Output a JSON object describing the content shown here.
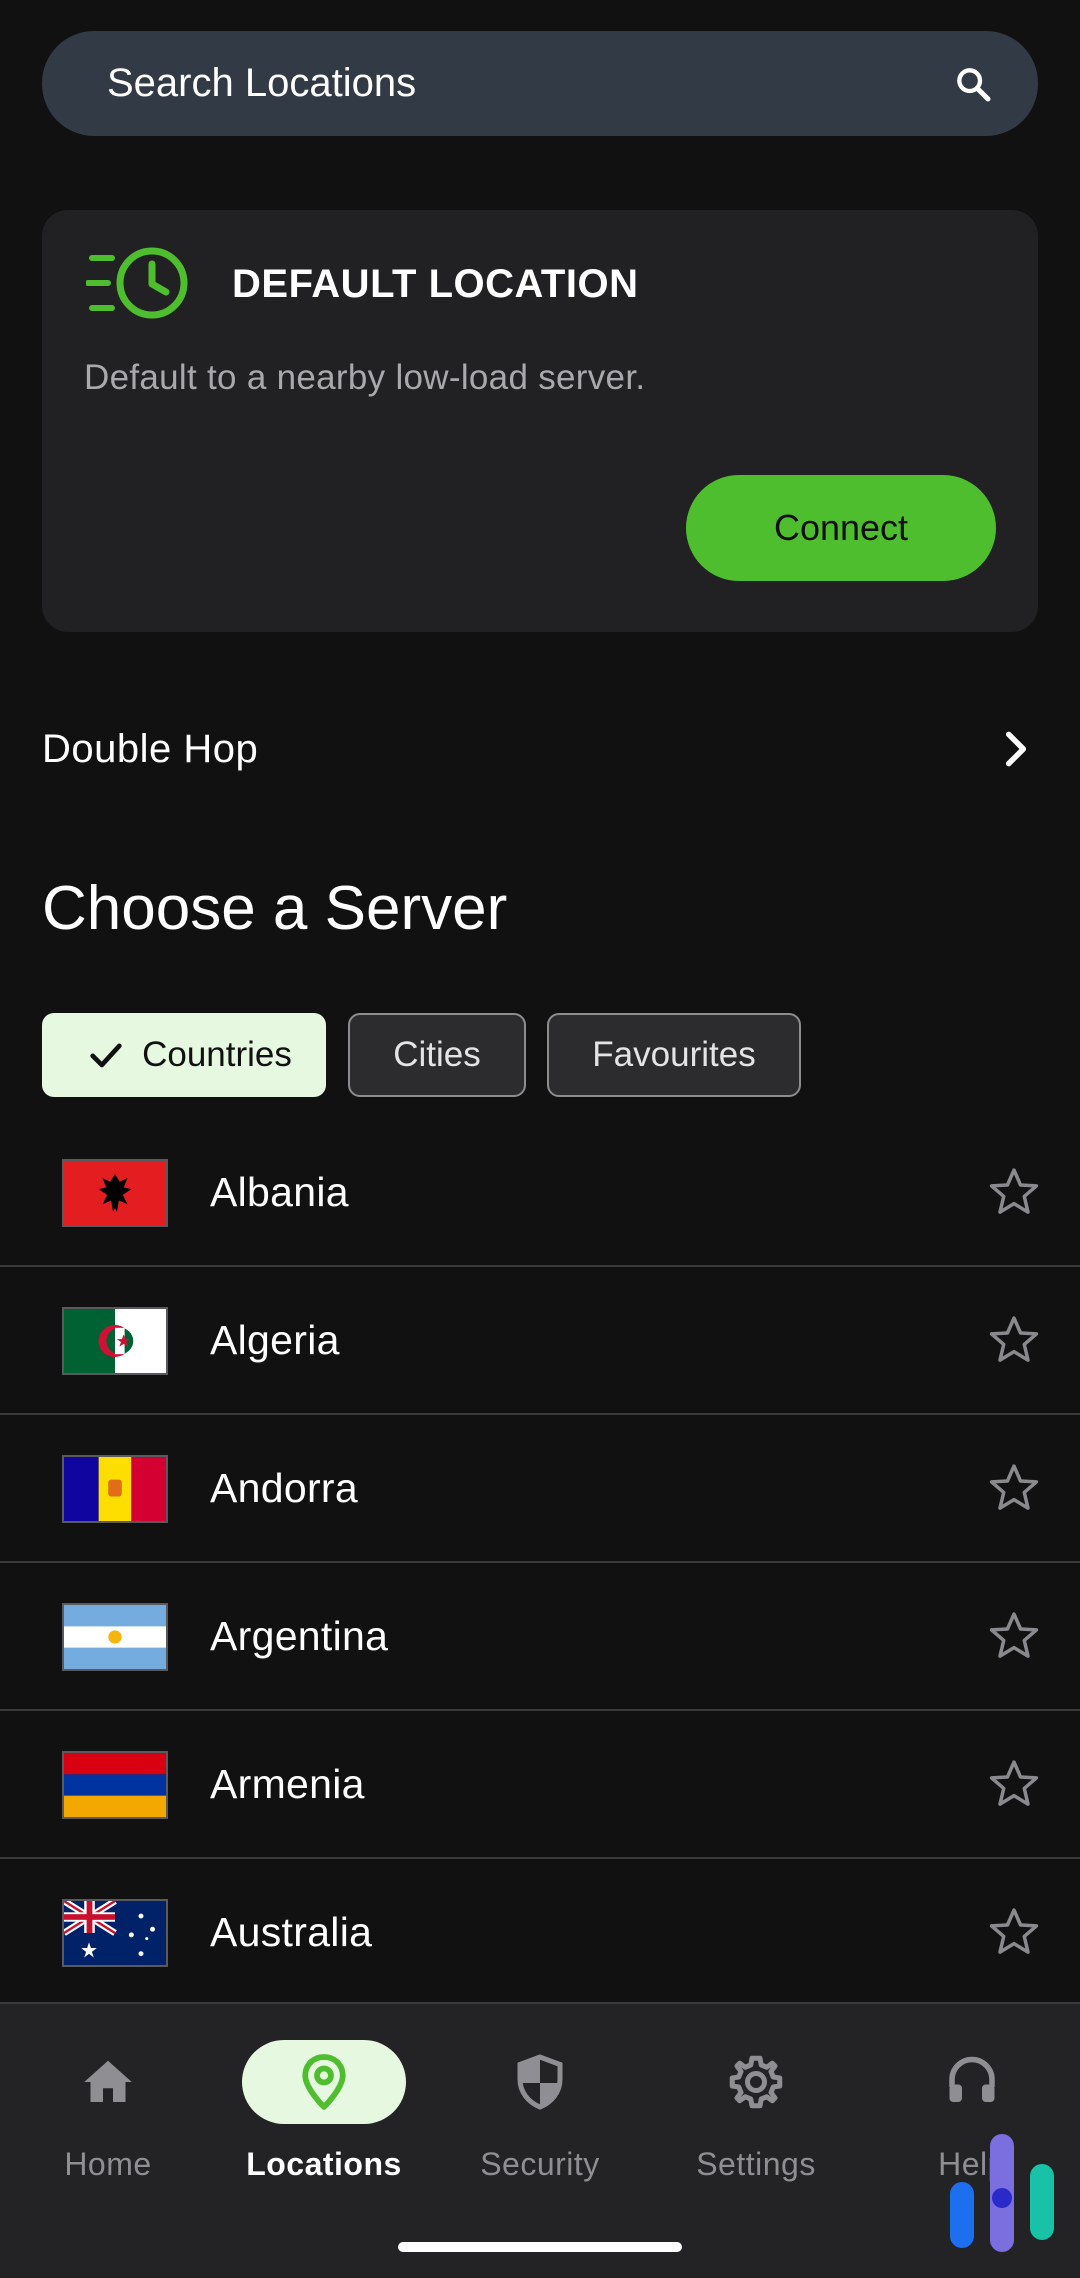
{
  "search": {
    "placeholder": "Search Locations",
    "icon": "search-icon"
  },
  "default_location": {
    "icon": "clock-speed-icon",
    "title": "DEFAULT LOCATION",
    "description": "Default to a nearby low-load server.",
    "connect_label": "Connect",
    "accent_color": "#4fbe2e"
  },
  "double_hop": {
    "label": "Double Hop",
    "icon": "chevron-right-icon"
  },
  "servers": {
    "title": "Choose a Server",
    "filters": [
      {
        "label": "Countries",
        "selected": true
      },
      {
        "label": "Cities",
        "selected": false
      },
      {
        "label": "Favourites",
        "selected": false
      }
    ],
    "countries": [
      {
        "name": "Albania",
        "flag": "albania-flag",
        "favourite": false
      },
      {
        "name": "Algeria",
        "flag": "algeria-flag",
        "favourite": false
      },
      {
        "name": "Andorra",
        "flag": "andorra-flag",
        "favourite": false
      },
      {
        "name": "Argentina",
        "flag": "argentina-flag",
        "favourite": false
      },
      {
        "name": "Armenia",
        "flag": "armenia-flag",
        "favourite": false
      },
      {
        "name": "Australia",
        "flag": "australia-flag",
        "favourite": false
      }
    ]
  },
  "nav": {
    "items": [
      {
        "label": "Home",
        "icon": "home-icon",
        "active": false
      },
      {
        "label": "Locations",
        "icon": "location-pin-icon",
        "active": true
      },
      {
        "label": "Security",
        "icon": "shield-icon",
        "active": false
      },
      {
        "label": "Settings",
        "icon": "gear-icon",
        "active": false
      },
      {
        "label": "Help",
        "icon": "headset-icon",
        "active": false
      }
    ]
  },
  "colors": {
    "background": "#111112",
    "card": "#212123",
    "accent_green": "#4fbe2e",
    "chip_selected": "#e6f8e0"
  }
}
